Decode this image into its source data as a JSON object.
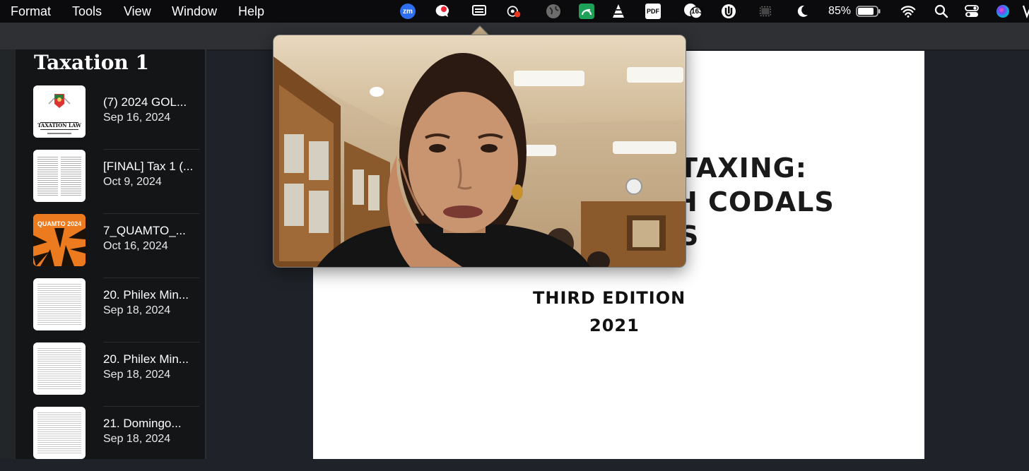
{
  "menubar": {
    "menus": [
      "Format",
      "Tools",
      "View",
      "Window",
      "Help"
    ],
    "tray": {
      "zoom_label": "zm",
      "pdf_label": "PDF",
      "badge_count": "163",
      "battery": "85%"
    }
  },
  "sidebar": {
    "title": "Taxation 1",
    "items": [
      {
        "name": "(7) 2024 GOL...",
        "date": "Sep 16, 2024",
        "thumb": "taxation-law-cover",
        "thumb_text": "TAXATION LAW"
      },
      {
        "name": "[FINAL] Tax 1 (...",
        "date": "Oct 9, 2024",
        "thumb": "two-column-text"
      },
      {
        "name": "7_QUAMTO_...",
        "date": "Oct 16, 2024",
        "thumb": "quamto-cover",
        "thumb_text": "QUAMTO 2024"
      },
      {
        "name": "20. Philex Min...",
        "date": "Sep 18, 2024",
        "thumb": "text-page"
      },
      {
        "name": "20. Philex Min...",
        "date": "Sep 18, 2024",
        "thumb": "text-page"
      },
      {
        "name": "21. Domingo...",
        "date": "Sep 18, 2024",
        "thumb": "text-page"
      }
    ]
  },
  "document": {
    "title_line1": "TAXING:",
    "title_line2": "H CODALS",
    "title_line3": "S",
    "edition": "THIRD EDITION",
    "year": "2021"
  },
  "colors": {
    "menubar": "#0b0b0d",
    "sidebar": "#141517",
    "background": "#1f2329",
    "page": "#ffffff"
  }
}
